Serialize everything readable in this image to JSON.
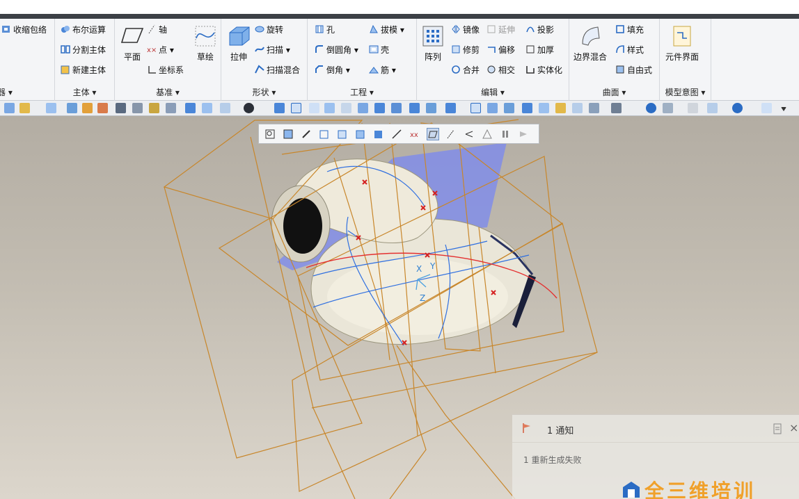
{
  "ribbon": {
    "groups": [
      {
        "label": "器 ▾",
        "items": [
          "收缩包络"
        ]
      },
      {
        "label": "主体 ▾",
        "items": [
          "布尔运算",
          "分割主体",
          "新建主体"
        ]
      },
      {
        "label": "基准 ▾",
        "items": [
          "平面",
          "轴",
          "点 ▾",
          "坐标系",
          "草绘"
        ]
      },
      {
        "label": "形状 ▾",
        "items": [
          "拉伸",
          "旋转",
          "扫描 ▾",
          "扫描混合"
        ]
      },
      {
        "label": "工程 ▾",
        "items": [
          "孔",
          "拔模 ▾",
          "倒圆角 ▾",
          "壳",
          "倒角 ▾",
          "筋 ▾"
        ]
      },
      {
        "label": "编辑 ▾",
        "items": [
          "阵列",
          "镜像",
          "延伸",
          "投影",
          "修剪",
          "偏移",
          "加厚",
          "合并",
          "相交",
          "实体化"
        ]
      },
      {
        "label": "曲面 ▾",
        "items": [
          "边界混合",
          "填充",
          "样式",
          "自由式"
        ]
      },
      {
        "label": "模型意图 ▾",
        "items": [
          "元件界面"
        ]
      }
    ]
  },
  "notification": {
    "title": "1 通知",
    "message": "1 重新生成失败",
    "close": "×"
  },
  "watermark": "全三维培训",
  "colors": {
    "ribbon_bg": "#f4f5f7",
    "viewport_top": "#b3ada3",
    "viewport_bottom": "#dcd6cc",
    "datum_plane": "#c8862a",
    "accent_blue": "#2a6fd1",
    "watermark": "#f0a02a"
  }
}
